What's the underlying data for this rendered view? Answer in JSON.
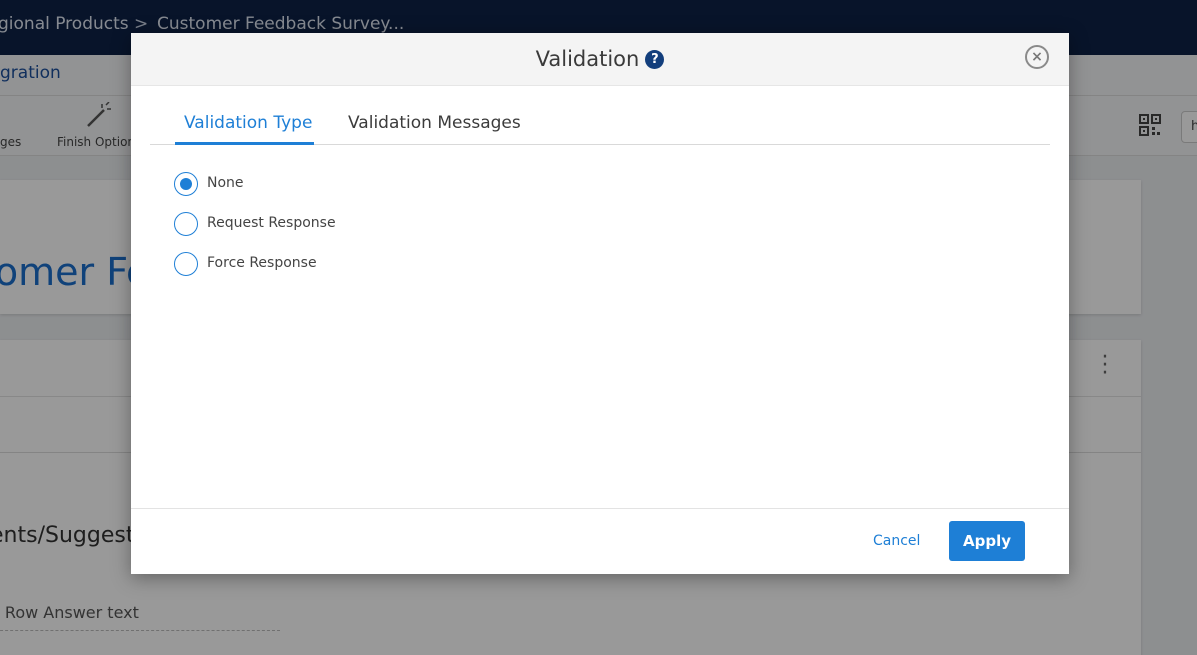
{
  "app": {
    "breadcrumb": [
      "gional Products",
      "Customer Feedback Survey..."
    ],
    "breadcrumb_separator": ">",
    "subnav_label": "gration",
    "toolbar_items": [
      "ges",
      "Finish Option"
    ],
    "toolbar_chip": "h",
    "survey_title_fragment": "tomer Fe",
    "question_title_fragment": "ents/Suggest",
    "answer_placeholder_fragment": "e Row Answer text"
  },
  "modal": {
    "title": "Validation",
    "help_icon": "?",
    "close_icon": "×",
    "tabs": [
      {
        "label": "Validation Type",
        "active": true
      },
      {
        "label": "Validation Messages",
        "active": false
      }
    ],
    "options": [
      {
        "label": "None",
        "selected": true
      },
      {
        "label": "Request Response",
        "selected": false
      },
      {
        "label": "Force Response",
        "selected": false
      }
    ],
    "footer": {
      "cancel_label": "Cancel",
      "apply_label": "Apply"
    }
  },
  "colors": {
    "accent": "#1e7fd6",
    "topbar": "#0e2247",
    "help_icon": "#123e7c"
  }
}
